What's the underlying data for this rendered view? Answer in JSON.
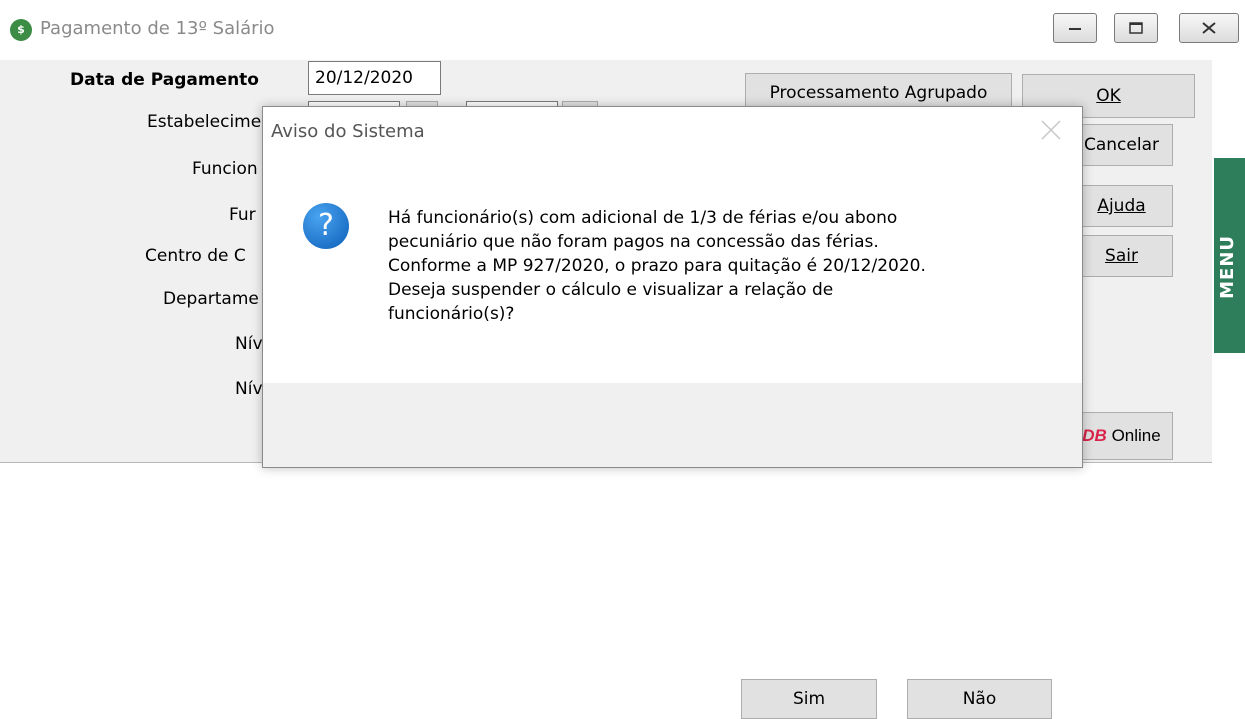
{
  "window": {
    "title": "Pagamento de 13º Salário",
    "app_icon": "money-icon"
  },
  "form": {
    "date_label": "Data de Pagamento",
    "date_value": "20/12/2020",
    "labels": [
      "Estabelecime",
      "Funcion",
      "Fur",
      "Centro de C",
      "Departame",
      "Nív",
      "Nív"
    ]
  },
  "buttons": {
    "processamento": "Processamento Agrupado",
    "ok": "OK",
    "cancelar": "Cancelar",
    "ajuda": "Ajuda",
    "sair": "Sair",
    "online_logo": "DB",
    "online_text": " Online"
  },
  "side_tab": {
    "label": "MENU",
    "color": "#2e7d5b"
  },
  "dialog": {
    "title": "Aviso do Sistema",
    "icon": "question-icon",
    "message": "Há funcionário(s) com adicional de 1/3 de férias e/ou abono\npecuniário que não foram pagos na concessão das férias.\nConforme a MP 927/2020, o prazo para quitação é 20/12/2020.\nDeseja suspender o cálculo e visualizar a relação de\nfuncionário(s)?",
    "yes": "Sim",
    "no": "Não"
  }
}
